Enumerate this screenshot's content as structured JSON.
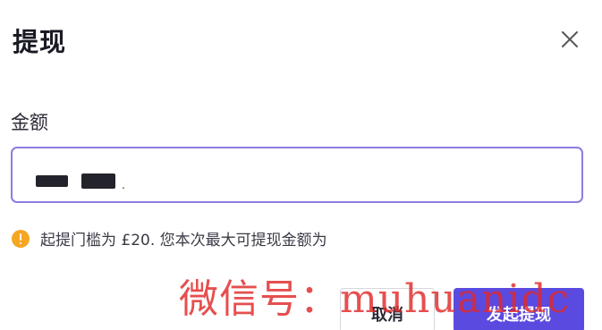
{
  "dialog": {
    "title": "提现",
    "close_icon": "close-icon"
  },
  "form": {
    "amount_label": "金额",
    "amount_value_suffix": "."
  },
  "hint": {
    "icon": "warning-icon",
    "icon_color": "#f5a623",
    "text": "起提门槛为 £20. 您本次最大可提现金额为"
  },
  "actions": {
    "cancel_label": "取消",
    "submit_label": "发起提现",
    "submit_color": "#5b4ae0"
  },
  "overlay": {
    "watermark_text": "微信号：muhuanidc"
  }
}
